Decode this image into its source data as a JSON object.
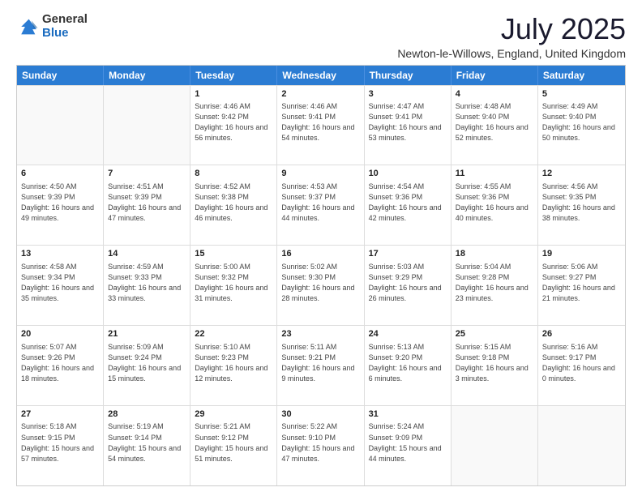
{
  "logo": {
    "general": "General",
    "blue": "Blue"
  },
  "title": {
    "month": "July 2025",
    "location": "Newton-le-Willows, England, United Kingdom"
  },
  "header_days": [
    "Sunday",
    "Monday",
    "Tuesday",
    "Wednesday",
    "Thursday",
    "Friday",
    "Saturday"
  ],
  "weeks": [
    [
      {
        "day": "",
        "sunrise": "",
        "sunset": "",
        "daylight": ""
      },
      {
        "day": "",
        "sunrise": "",
        "sunset": "",
        "daylight": ""
      },
      {
        "day": "1",
        "sunrise": "Sunrise: 4:46 AM",
        "sunset": "Sunset: 9:42 PM",
        "daylight": "Daylight: 16 hours and 56 minutes."
      },
      {
        "day": "2",
        "sunrise": "Sunrise: 4:46 AM",
        "sunset": "Sunset: 9:41 PM",
        "daylight": "Daylight: 16 hours and 54 minutes."
      },
      {
        "day": "3",
        "sunrise": "Sunrise: 4:47 AM",
        "sunset": "Sunset: 9:41 PM",
        "daylight": "Daylight: 16 hours and 53 minutes."
      },
      {
        "day": "4",
        "sunrise": "Sunrise: 4:48 AM",
        "sunset": "Sunset: 9:40 PM",
        "daylight": "Daylight: 16 hours and 52 minutes."
      },
      {
        "day": "5",
        "sunrise": "Sunrise: 4:49 AM",
        "sunset": "Sunset: 9:40 PM",
        "daylight": "Daylight: 16 hours and 50 minutes."
      }
    ],
    [
      {
        "day": "6",
        "sunrise": "Sunrise: 4:50 AM",
        "sunset": "Sunset: 9:39 PM",
        "daylight": "Daylight: 16 hours and 49 minutes."
      },
      {
        "day": "7",
        "sunrise": "Sunrise: 4:51 AM",
        "sunset": "Sunset: 9:39 PM",
        "daylight": "Daylight: 16 hours and 47 minutes."
      },
      {
        "day": "8",
        "sunrise": "Sunrise: 4:52 AM",
        "sunset": "Sunset: 9:38 PM",
        "daylight": "Daylight: 16 hours and 46 minutes."
      },
      {
        "day": "9",
        "sunrise": "Sunrise: 4:53 AM",
        "sunset": "Sunset: 9:37 PM",
        "daylight": "Daylight: 16 hours and 44 minutes."
      },
      {
        "day": "10",
        "sunrise": "Sunrise: 4:54 AM",
        "sunset": "Sunset: 9:36 PM",
        "daylight": "Daylight: 16 hours and 42 minutes."
      },
      {
        "day": "11",
        "sunrise": "Sunrise: 4:55 AM",
        "sunset": "Sunset: 9:36 PM",
        "daylight": "Daylight: 16 hours and 40 minutes."
      },
      {
        "day": "12",
        "sunrise": "Sunrise: 4:56 AM",
        "sunset": "Sunset: 9:35 PM",
        "daylight": "Daylight: 16 hours and 38 minutes."
      }
    ],
    [
      {
        "day": "13",
        "sunrise": "Sunrise: 4:58 AM",
        "sunset": "Sunset: 9:34 PM",
        "daylight": "Daylight: 16 hours and 35 minutes."
      },
      {
        "day": "14",
        "sunrise": "Sunrise: 4:59 AM",
        "sunset": "Sunset: 9:33 PM",
        "daylight": "Daylight: 16 hours and 33 minutes."
      },
      {
        "day": "15",
        "sunrise": "Sunrise: 5:00 AM",
        "sunset": "Sunset: 9:32 PM",
        "daylight": "Daylight: 16 hours and 31 minutes."
      },
      {
        "day": "16",
        "sunrise": "Sunrise: 5:02 AM",
        "sunset": "Sunset: 9:30 PM",
        "daylight": "Daylight: 16 hours and 28 minutes."
      },
      {
        "day": "17",
        "sunrise": "Sunrise: 5:03 AM",
        "sunset": "Sunset: 9:29 PM",
        "daylight": "Daylight: 16 hours and 26 minutes."
      },
      {
        "day": "18",
        "sunrise": "Sunrise: 5:04 AM",
        "sunset": "Sunset: 9:28 PM",
        "daylight": "Daylight: 16 hours and 23 minutes."
      },
      {
        "day": "19",
        "sunrise": "Sunrise: 5:06 AM",
        "sunset": "Sunset: 9:27 PM",
        "daylight": "Daylight: 16 hours and 21 minutes."
      }
    ],
    [
      {
        "day": "20",
        "sunrise": "Sunrise: 5:07 AM",
        "sunset": "Sunset: 9:26 PM",
        "daylight": "Daylight: 16 hours and 18 minutes."
      },
      {
        "day": "21",
        "sunrise": "Sunrise: 5:09 AM",
        "sunset": "Sunset: 9:24 PM",
        "daylight": "Daylight: 16 hours and 15 minutes."
      },
      {
        "day": "22",
        "sunrise": "Sunrise: 5:10 AM",
        "sunset": "Sunset: 9:23 PM",
        "daylight": "Daylight: 16 hours and 12 minutes."
      },
      {
        "day": "23",
        "sunrise": "Sunrise: 5:11 AM",
        "sunset": "Sunset: 9:21 PM",
        "daylight": "Daylight: 16 hours and 9 minutes."
      },
      {
        "day": "24",
        "sunrise": "Sunrise: 5:13 AM",
        "sunset": "Sunset: 9:20 PM",
        "daylight": "Daylight: 16 hours and 6 minutes."
      },
      {
        "day": "25",
        "sunrise": "Sunrise: 5:15 AM",
        "sunset": "Sunset: 9:18 PM",
        "daylight": "Daylight: 16 hours and 3 minutes."
      },
      {
        "day": "26",
        "sunrise": "Sunrise: 5:16 AM",
        "sunset": "Sunset: 9:17 PM",
        "daylight": "Daylight: 16 hours and 0 minutes."
      }
    ],
    [
      {
        "day": "27",
        "sunrise": "Sunrise: 5:18 AM",
        "sunset": "Sunset: 9:15 PM",
        "daylight": "Daylight: 15 hours and 57 minutes."
      },
      {
        "day": "28",
        "sunrise": "Sunrise: 5:19 AM",
        "sunset": "Sunset: 9:14 PM",
        "daylight": "Daylight: 15 hours and 54 minutes."
      },
      {
        "day": "29",
        "sunrise": "Sunrise: 5:21 AM",
        "sunset": "Sunset: 9:12 PM",
        "daylight": "Daylight: 15 hours and 51 minutes."
      },
      {
        "day": "30",
        "sunrise": "Sunrise: 5:22 AM",
        "sunset": "Sunset: 9:10 PM",
        "daylight": "Daylight: 15 hours and 47 minutes."
      },
      {
        "day": "31",
        "sunrise": "Sunrise: 5:24 AM",
        "sunset": "Sunset: 9:09 PM",
        "daylight": "Daylight: 15 hours and 44 minutes."
      },
      {
        "day": "",
        "sunrise": "",
        "sunset": "",
        "daylight": ""
      },
      {
        "day": "",
        "sunrise": "",
        "sunset": "",
        "daylight": ""
      }
    ]
  ]
}
